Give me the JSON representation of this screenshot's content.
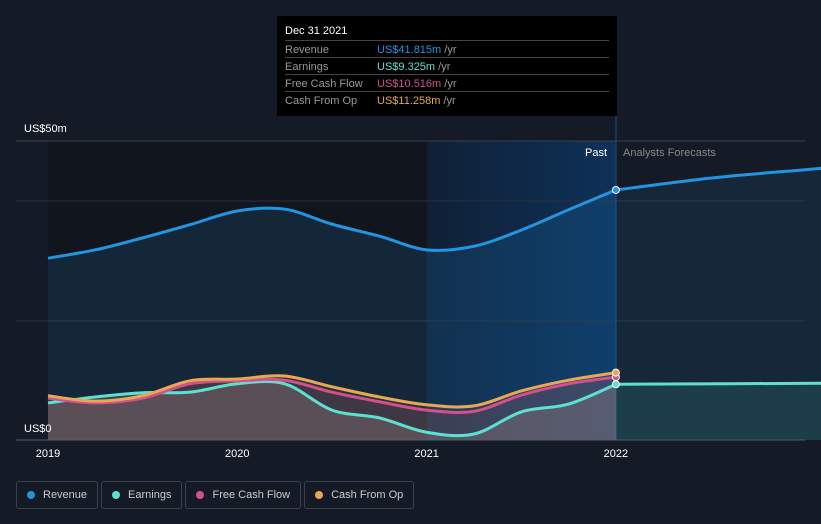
{
  "tooltip": {
    "date": "Dec 31 2021",
    "unit": "/yr",
    "rows": [
      {
        "label": "Revenue",
        "value": "US$41.815m",
        "color": "#2394e0"
      },
      {
        "label": "Earnings",
        "value": "US$9.325m",
        "color": "#5ee0d0"
      },
      {
        "label": "Free Cash Flow",
        "value": "US$10.516m",
        "color": "#d44f8e"
      },
      {
        "label": "Cash From Op",
        "value": "US$11.258m",
        "color": "#e8a852"
      }
    ]
  },
  "labels": {
    "past": "Past",
    "forecast": "Analysts Forecasts"
  },
  "chart_data": {
    "type": "line",
    "ylabel_top": "US$50m",
    "ylabel_bottom": "US$0",
    "ylim": [
      0,
      50
    ],
    "xlim": [
      2019,
      2023.2
    ],
    "xticks": [
      "2019",
      "2020",
      "2021",
      "2022"
    ],
    "grid": true,
    "legend_position": "bottom-left",
    "past_end": 2022,
    "series": [
      {
        "name": "Revenue",
        "color": "#2394e0",
        "x": [
          2019,
          2019.25,
          2019.5,
          2019.75,
          2020,
          2020.25,
          2020.5,
          2020.75,
          2021,
          2021.25,
          2021.5,
          2021.75,
          2022
        ],
        "values": [
          30.4,
          31.8,
          33.8,
          36,
          38.3,
          38.6,
          36.1,
          34.1,
          31.8,
          32.4,
          35.1,
          38.5,
          41.815
        ],
        "forecast": {
          "x": [
            2022,
            2022.5,
            2023,
            2023.2
          ],
          "values": [
            41.815,
            43.8,
            45.2,
            45.7
          ]
        }
      },
      {
        "name": "Earnings",
        "color": "#5ee0d0",
        "x": [
          2019,
          2019.25,
          2019.5,
          2019.75,
          2020,
          2020.25,
          2020.5,
          2020.75,
          2021,
          2021.25,
          2021.5,
          2021.75,
          2022
        ],
        "values": [
          6.2,
          7.2,
          7.9,
          8.0,
          9.4,
          9.4,
          5.0,
          3.7,
          1.3,
          1.0,
          4.7,
          6.0,
          9.325
        ],
        "forecast": {
          "x": [
            2022,
            2023.2
          ],
          "values": [
            9.325,
            9.5
          ]
        }
      },
      {
        "name": "Free Cash Flow",
        "color": "#d44f8e",
        "x": [
          2019,
          2019.25,
          2019.5,
          2019.75,
          2020,
          2020.25,
          2020.5,
          2020.75,
          2021,
          2021.25,
          2021.5,
          2021.75,
          2022
        ],
        "values": [
          7.0,
          6.2,
          7.0,
          9.4,
          9.9,
          10.0,
          8.0,
          6.4,
          5.0,
          4.8,
          7.5,
          9.4,
          10.516
        ]
      },
      {
        "name": "Cash From Op",
        "color": "#e8a852",
        "x": [
          2019,
          2019.25,
          2019.5,
          2019.75,
          2020,
          2020.25,
          2020.5,
          2020.75,
          2021,
          2021.25,
          2021.5,
          2021.75,
          2022
        ],
        "values": [
          7.4,
          6.5,
          7.4,
          9.9,
          10.2,
          10.7,
          8.9,
          7.2,
          5.9,
          5.7,
          8.2,
          10.0,
          11.258
        ]
      }
    ]
  }
}
